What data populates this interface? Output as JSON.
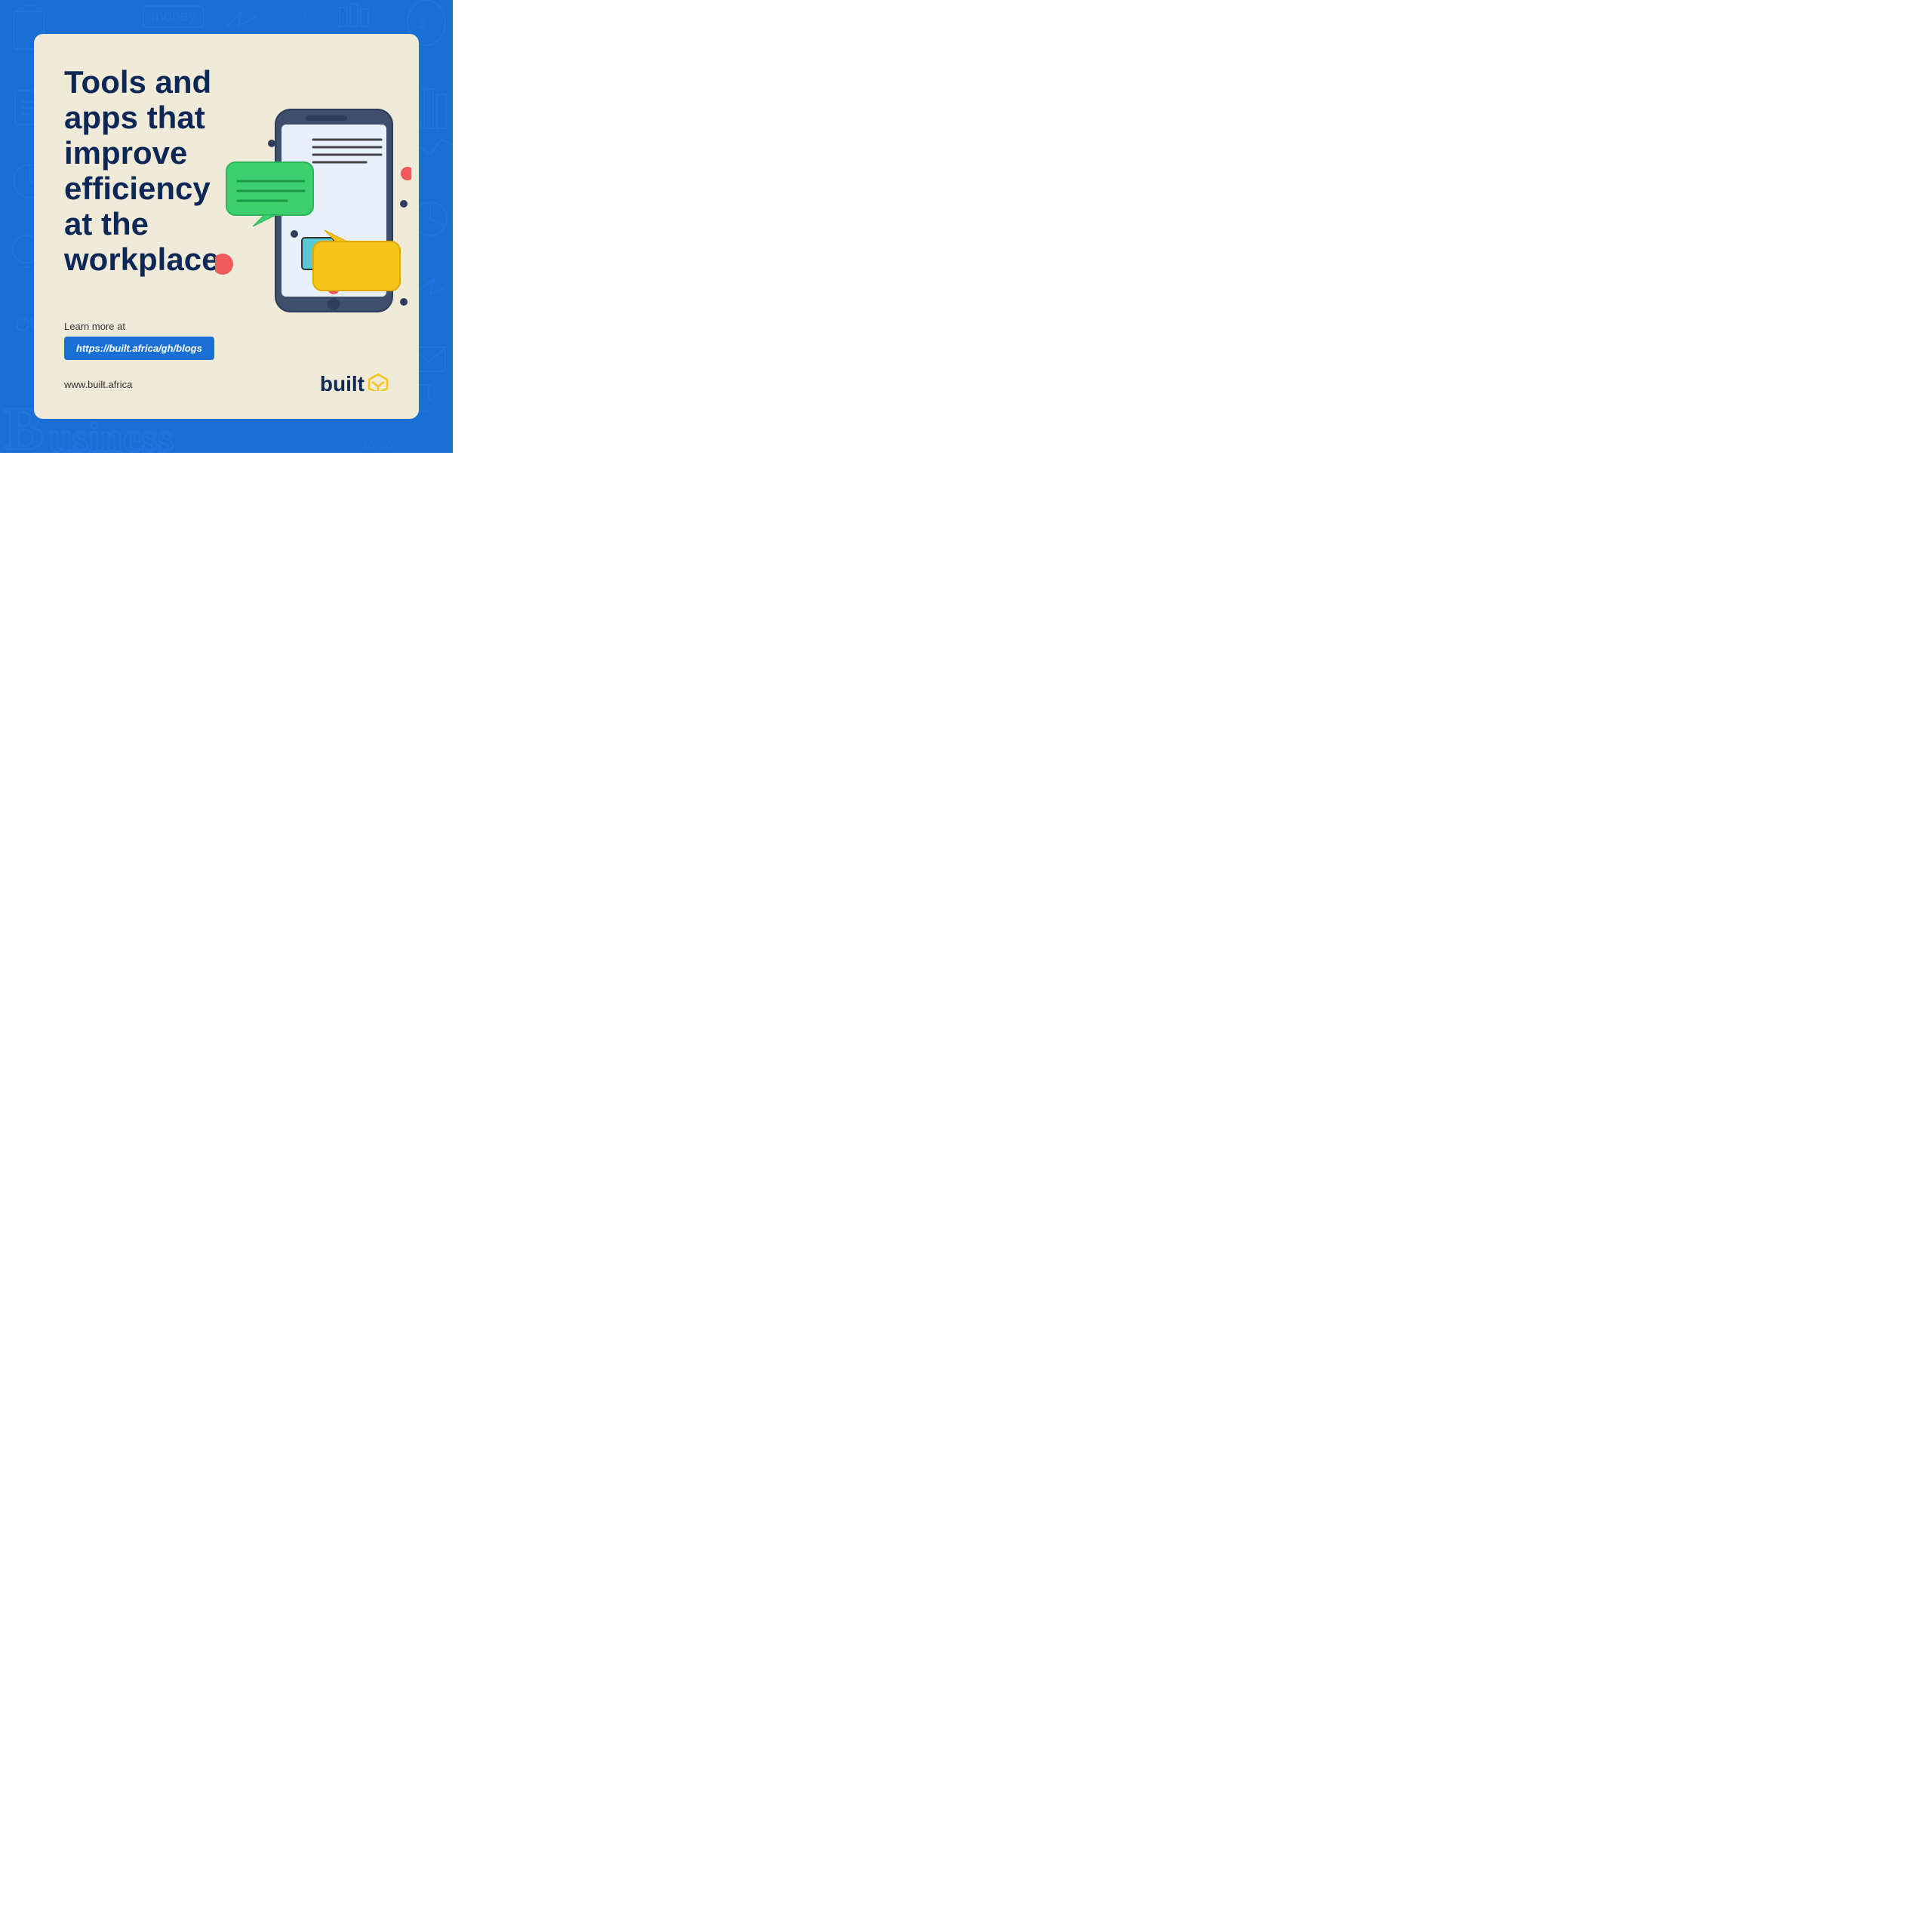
{
  "outer": {
    "bg_color": "#1a6fd4"
  },
  "card": {
    "bg_color": "#f0ead8"
  },
  "headline": "Tools and apps that improve efficiency at the workplace.",
  "learn_more_label": "Learn more at",
  "url_label": "https://built.africa/gh/blogs",
  "website_label": "www.built.africa",
  "brand_name": "built",
  "brand_icon": "⬡"
}
